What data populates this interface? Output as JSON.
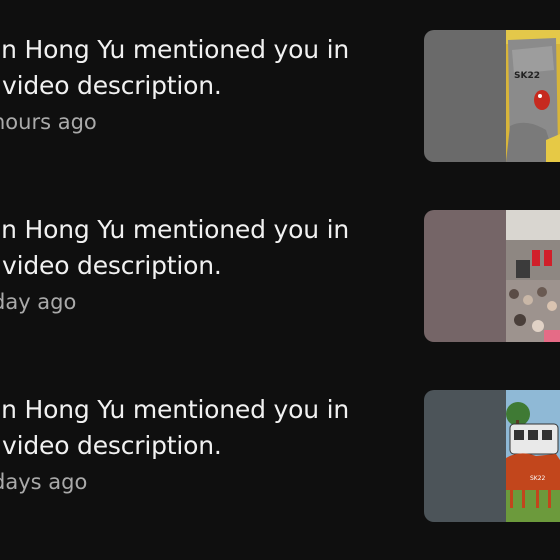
{
  "notifications": [
    {
      "message": "an Hong Yu mentioned you in video description.",
      "line1": "an Hong Yu mentioned you in",
      "line2": "video description.",
      "time": "hours ago",
      "pad_color": "#6a6a6a",
      "thumb_icon": "video-thumbnail-cartoon-sk22",
      "thumb_text": "SK22"
    },
    {
      "message": "an Hong Yu mentioned you in video description.",
      "line1": "an Hong Yu mentioned you in",
      "line2": "video description.",
      "time": "day ago",
      "pad_color": "#756567",
      "thumb_icon": "video-thumbnail-crowd-event"
    },
    {
      "message": "an Hong Yu mentioned you in video description.",
      "line1": "an Hong Yu mentioned you in",
      "line2": "video description.",
      "time": "days ago",
      "pad_color": "#4c5459",
      "thumb_icon": "video-thumbnail-cartoon-cow-van",
      "thumb_text": "SK22"
    }
  ]
}
